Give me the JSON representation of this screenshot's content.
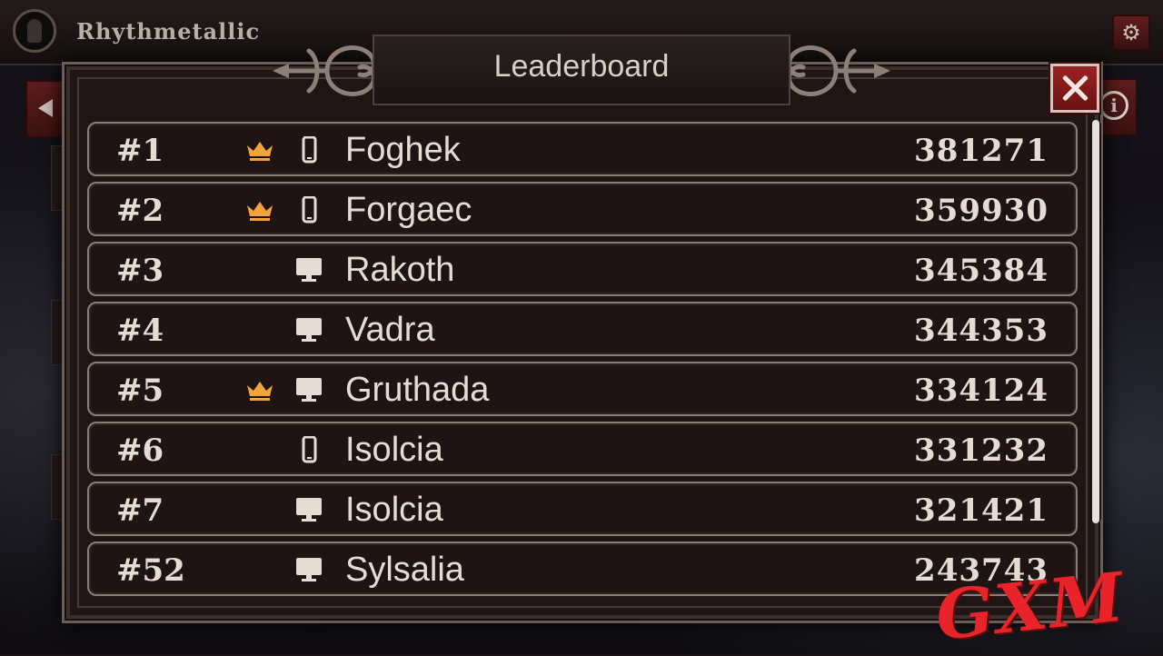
{
  "app": {
    "title": "Rhythmetallic"
  },
  "modal": {
    "title": "Leaderboard"
  },
  "icons": {
    "avatar": "avatar-icon",
    "settings": "gear-icon",
    "back": "arrow-left-icon",
    "info": "info-icon",
    "close": "close-icon",
    "crown": "crown-icon",
    "mobile": "phone-icon",
    "desktop": "monitor-icon"
  },
  "colors": {
    "crown": "#f2a33a",
    "close_button": "#9b2322",
    "row_border": "#8a7d74",
    "watermark": "#e8232a"
  },
  "info_label": "i",
  "leaderboard": [
    {
      "rank": "#1",
      "crown": true,
      "device": "mobile",
      "name": "Foghek",
      "score": "381271"
    },
    {
      "rank": "#2",
      "crown": true,
      "device": "mobile",
      "name": "Forgaec",
      "score": "359930"
    },
    {
      "rank": "#3",
      "crown": false,
      "device": "desktop",
      "name": "Rakoth",
      "score": "345384"
    },
    {
      "rank": "#4",
      "crown": false,
      "device": "desktop",
      "name": "Vadra",
      "score": "344353"
    },
    {
      "rank": "#5",
      "crown": true,
      "device": "desktop",
      "name": "Gruthada",
      "score": "334124"
    },
    {
      "rank": "#6",
      "crown": false,
      "device": "mobile",
      "name": "Isolcia",
      "score": "331232"
    },
    {
      "rank": "#7",
      "crown": false,
      "device": "desktop",
      "name": "Isolcia",
      "score": "321421"
    },
    {
      "rank": "#52",
      "crown": false,
      "device": "desktop",
      "name": "Sylsalia",
      "score": "243743"
    }
  ],
  "watermark": "GXM"
}
